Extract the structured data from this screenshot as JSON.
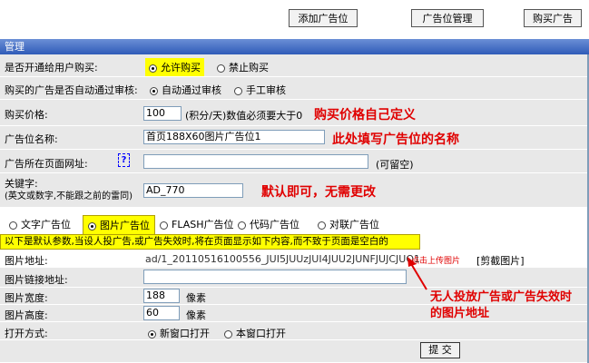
{
  "toolbar": {
    "add_label": "添加广告位",
    "manage_label": "广告位管理",
    "buy_label": "购买广告"
  },
  "header": {
    "title": "管理"
  },
  "form": {
    "allow_buy": {
      "label": "是否开通给用户购买:",
      "opt1": "允许购买",
      "opt2": "禁止购买"
    },
    "auto_pass": {
      "label": "购买的广告是否自动通过审核:",
      "opt1": "自动通过审核",
      "opt2": "手工审核"
    },
    "price": {
      "label": "购买价格:",
      "value": "100",
      "hint": "(积分/天)数值必须要大于0",
      "annotation": "购买价格自己定义"
    },
    "name": {
      "label": "广告位名称:",
      "value": "首页188X60图片广告位1",
      "annotation": "此处填写广告位的名称"
    },
    "page_url": {
      "label": "广告所在页面网址:",
      "help": "?",
      "value": "",
      "hint": "(可留空)"
    },
    "keyword": {
      "label1": "关键字:",
      "label2": "(英文或数字,不能跟之前的雷同)",
      "value": "AD_770",
      "annotation": "默认即可，无需更改"
    },
    "types": [
      "文字广告位",
      "图片广告位",
      "FLASH广告位",
      "代码广告位",
      "对联广告位"
    ],
    "note": "以下是默认参数,当设人投广告,或广告失效时,将在页面显示如下内容,而不致于页面是空白的",
    "image_url": {
      "label": "图片地址:",
      "value": "ad/1_20110516100556_JUI5JUUzJUI4JUU2JUNFJUJCJUQ1",
      "upload": "点击上传图片",
      "crop": "[剪截图片]"
    },
    "image_link": {
      "label": "图片链接地址:",
      "value": ""
    },
    "width": {
      "label": "图片宽度:",
      "value": "188",
      "unit": "像素"
    },
    "height": {
      "label": "图片高度:",
      "value": "60",
      "unit": "像素"
    },
    "open_mode": {
      "label": "打开方式:",
      "opt1": "新窗口打开",
      "opt2": "本窗口打开"
    },
    "image_annotation_line1": "无人投放广告或广告失效时",
    "image_annotation_line2": "的图片地址",
    "submit": "提 交"
  },
  "colors": {
    "annotation": "#e00000",
    "highlight": "#ffff00",
    "header": "#2f5bb8"
  }
}
